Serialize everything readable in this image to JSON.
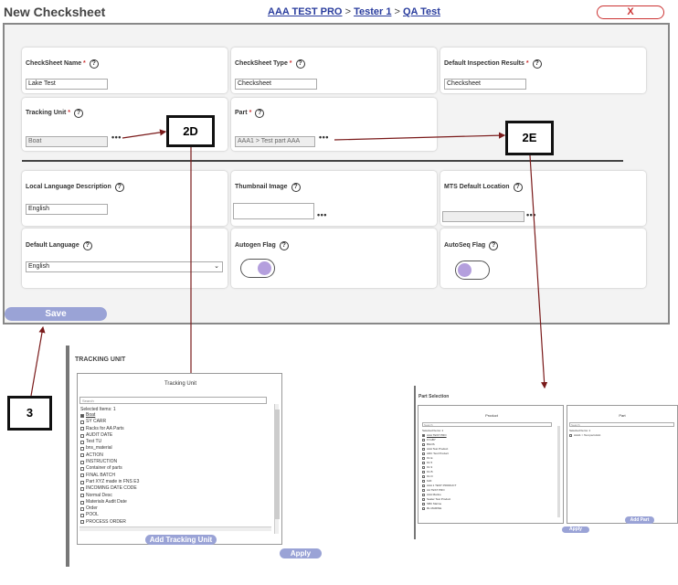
{
  "header": {
    "title": "New Checksheet",
    "breadcrumb": [
      "AAA TEST PRO",
      "Tester 1",
      "QA Test"
    ],
    "separator": ">",
    "close_label": "X"
  },
  "form": {
    "checksheet_name": {
      "label": "CheckSheet Name",
      "value": "Lake Test"
    },
    "checksheet_type": {
      "label": "CheckSheet Type",
      "value": "Checksheet"
    },
    "default_inspection": {
      "label": "Default Inspection Results",
      "value": "Checksheet"
    },
    "tracking_unit": {
      "label": "Tracking Unit",
      "value": "Boat"
    },
    "part": {
      "label": "Part",
      "value": "AAA1 > Test part AAA"
    },
    "local_language_desc": {
      "label": "Local Language Description",
      "value": "English"
    },
    "thumbnail_image": {
      "label": "Thumbnail Image",
      "value": ""
    },
    "mts_default_location": {
      "label": "MTS Default Location",
      "value": ""
    },
    "default_language": {
      "label": "Default Language",
      "value": "English"
    },
    "autogen_flag": {
      "label": "Autogen Flag",
      "on": true
    },
    "autoseq_flag": {
      "label": "AutoSeq Flag",
      "on": false
    },
    "asterisk": "*",
    "help_glyph": "?",
    "dots": "•••",
    "save_label": "Save"
  },
  "callouts": {
    "c2d": "2D",
    "c2e": "2E",
    "c3": "3"
  },
  "tracking_unit_panel": {
    "heading": "TRACKING UNIT",
    "title": "Tracking Unit",
    "search_placeholder": "Search",
    "selected_label": "Selected Items:",
    "selected_count": "1",
    "items": [
      {
        "label": "Boat",
        "checked": true
      },
      {
        "label": "SY CARR",
        "checked": false
      },
      {
        "label": "Racks for AA Parts",
        "checked": false
      },
      {
        "label": "AUDIT DATE",
        "checked": false
      },
      {
        "label": "Test TU",
        "checked": false
      },
      {
        "label": "bns_material",
        "checked": false
      },
      {
        "label": "ACTION",
        "checked": false
      },
      {
        "label": "INSTRUCTION",
        "checked": false
      },
      {
        "label": "Container of parts",
        "checked": false
      },
      {
        "label": "FINAL BATCH",
        "checked": false
      },
      {
        "label": "Part XYZ made in FNS E3",
        "checked": false
      },
      {
        "label": "INCOMING DATE CODE",
        "checked": false
      },
      {
        "label": "Normal Desc",
        "checked": false
      },
      {
        "label": "Materials Audit Date",
        "checked": false
      },
      {
        "label": "Order",
        "checked": false
      },
      {
        "label": "POOL",
        "checked": false
      },
      {
        "label": "PROCESS ORDER",
        "checked": false
      }
    ],
    "add_label": "Add Tracking Unit",
    "apply_label": "Apply"
  },
  "part_panel": {
    "heading": "Part Selection",
    "product_title": "Product",
    "part_title": "Part",
    "product_search": "Search",
    "part_search": "Search",
    "product_selected_label": "Selected Items:",
    "product_selected_count": "1",
    "part_selected_label": "Selected Items:",
    "part_selected_count": "1",
    "product_items": [
      {
        "label": "AAA TEST PRO",
        "checked": true
      },
      {
        "label": "FI GBY",
        "checked": false
      },
      {
        "label": "BGOS",
        "checked": false
      },
      {
        "label": "AAA Test Product",
        "checked": false
      },
      {
        "label": "ADC Test Product",
        "checked": false
      },
      {
        "label": "K1 E",
        "checked": false
      },
      {
        "label": "K1 5",
        "checked": false
      },
      {
        "label": "K1 9",
        "checked": false
      },
      {
        "label": "K1 B",
        "checked": false
      },
      {
        "label": "K1 D",
        "checked": false
      },
      {
        "label": "K20",
        "checked": false
      },
      {
        "label": "AAA 1 TEST PRODUCT",
        "checked": false
      },
      {
        "label": "AA TEST PRO",
        "checked": false
      },
      {
        "label": "AAA Marine",
        "checked": false
      },
      {
        "label": "Sealer Test Product",
        "checked": false
      },
      {
        "label": "SBC Marine",
        "checked": false
      },
      {
        "label": "RL MARINE",
        "checked": false
      }
    ],
    "part_items": [
      {
        "label": "AAA1 > Test part AAA",
        "checked": false
      }
    ],
    "add_label": "Add Part",
    "apply_label": "Apply"
  }
}
